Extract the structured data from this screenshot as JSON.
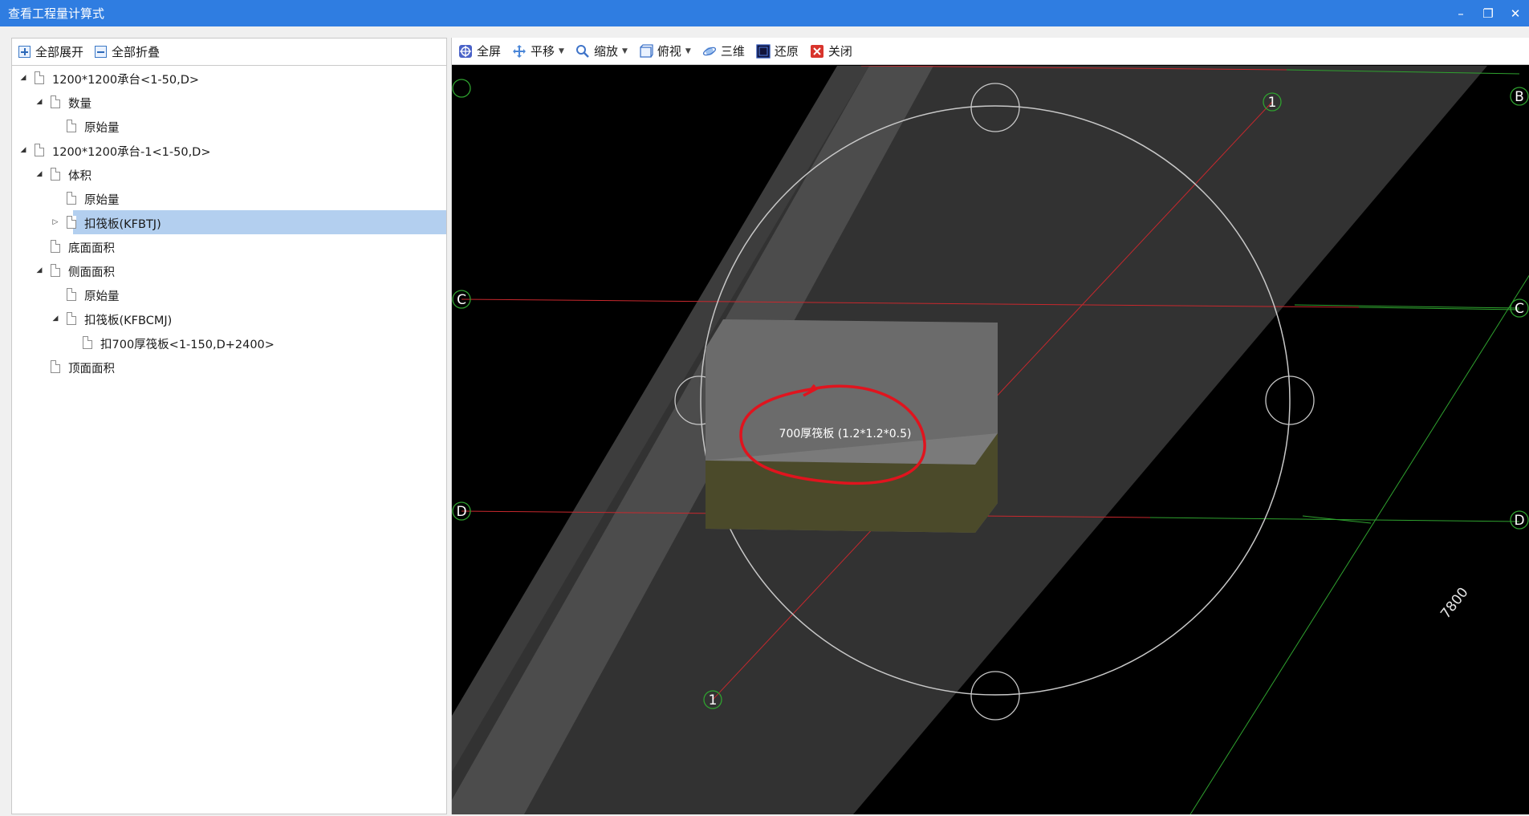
{
  "window": {
    "title": "查看工程量计算式",
    "minimize": "–",
    "restore": "❐",
    "close": "✕"
  },
  "left_toolbar": {
    "expand_all": "全部展开",
    "collapse_all": "全部折叠"
  },
  "tree": [
    {
      "label": "1200*1200承台<1-50,D>",
      "toggle": "◢"
    },
    {
      "label": "数量",
      "toggle": "◢"
    },
    {
      "label": "原始量",
      "toggle": ""
    },
    {
      "label": "1200*1200承台-1<1-50,D>",
      "toggle": "◢"
    },
    {
      "label": "体积",
      "toggle": "◢"
    },
    {
      "label": "原始量",
      "toggle": ""
    },
    {
      "label": "扣筏板(KFBTJ)",
      "toggle": "▷"
    },
    {
      "label": "底面面积",
      "toggle": ""
    },
    {
      "label": "侧面面积",
      "toggle": "◢"
    },
    {
      "label": "原始量",
      "toggle": ""
    },
    {
      "label": "扣筏板(KFBCMJ)",
      "toggle": "◢"
    },
    {
      "label": "扣700厚筏板<1-150,D+2400>",
      "toggle": ""
    },
    {
      "label": "顶面面积",
      "toggle": ""
    }
  ],
  "view_toolbar": {
    "fullscreen": "全屏",
    "pan": "平移",
    "zoom": "缩放",
    "top_view": "俯视",
    "three_d": "三维",
    "restore": "还原",
    "close": "关闭"
  },
  "viewport": {
    "axis_labels": {
      "b": "B",
      "c_left": "C",
      "c_right": "C",
      "d_left": "D",
      "d_right": "D",
      "one_top": "1",
      "one_bottom": "1"
    },
    "dimension": "7800",
    "annotation": "700厚筏板 (1.2*1.2*0.5)"
  },
  "colors": {
    "titlebar": "#2f7de1",
    "selected": "#b3cfef",
    "axis_red": "#c8282d",
    "axis_green": "#2fa22f",
    "highlight_circle": "#e0141e"
  }
}
